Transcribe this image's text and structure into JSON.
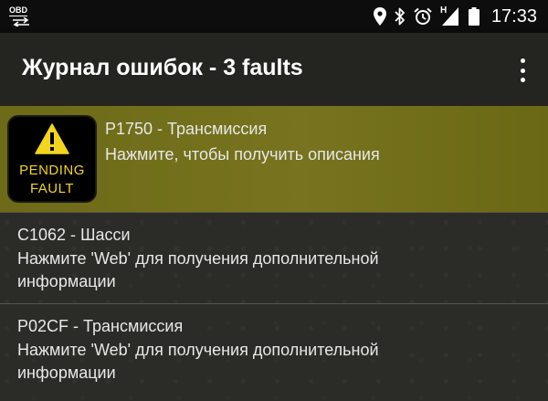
{
  "status_bar": {
    "obd_label": "OBD",
    "time": "17:33",
    "network_type": "H",
    "icons": [
      "obd-arrows-icon",
      "location-icon",
      "bluetooth-icon",
      "alarm-icon",
      "signal-icon",
      "battery-icon"
    ]
  },
  "app_bar": {
    "title": "Журнал ошибок - 3 faults",
    "overflow_icon": "more-vert-icon"
  },
  "faults": [
    {
      "code": "P1750 - Трансмиссия",
      "description": "Нажмите, чтобы получить описания",
      "status": "pending",
      "badge_line1": "PENDING",
      "badge_line2": "FAULT",
      "badge_icon": "warning-triangle-icon"
    },
    {
      "code": "C1062 - Шасси",
      "description": "Нажмите 'Web' для получения дополнительной информации"
    },
    {
      "code": "P02CF - Трансмиссия",
      "description": "Нажмите 'Web' для получения дополнительной информации"
    }
  ],
  "colors": {
    "selected_row": "#77731e",
    "badge_text": "#f2d51f",
    "background": "#2b2b27"
  }
}
